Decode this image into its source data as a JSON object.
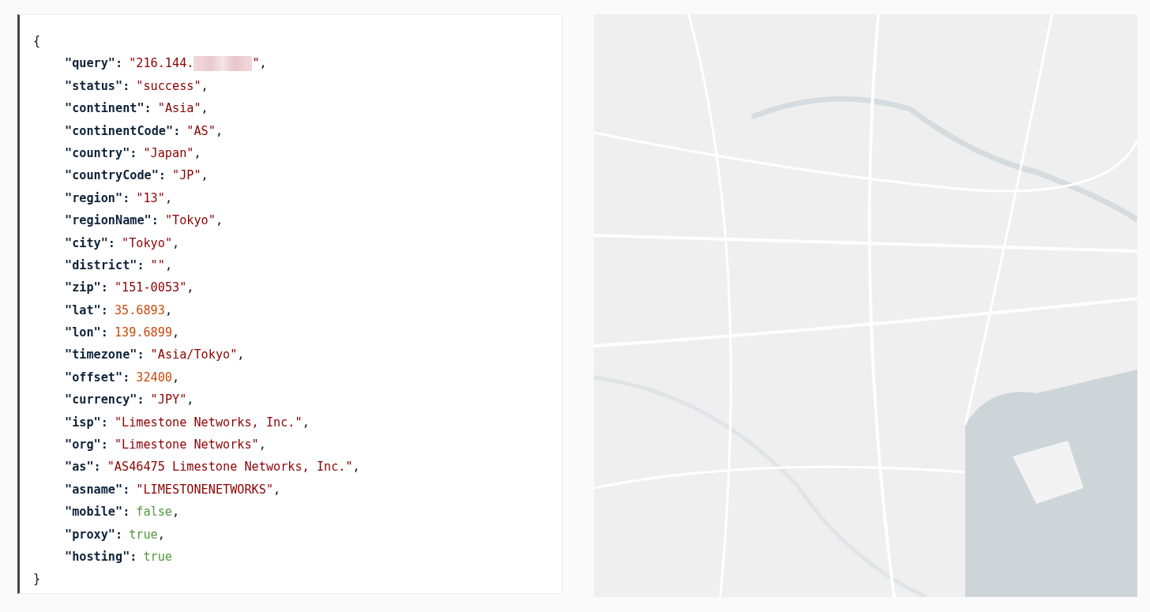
{
  "code_block": {
    "open": "{",
    "close": "}",
    "lines": [
      {
        "key": "\"query\":",
        "kind": "string",
        "value": "\"216.144.",
        "redacted": true,
        "value_end": "\"",
        "punct": ","
      },
      {
        "key": "\"status\":",
        "kind": "string",
        "value": "\"success\"",
        "punct": ","
      },
      {
        "key": "\"continent\":",
        "kind": "string",
        "value": "\"Asia\"",
        "punct": ","
      },
      {
        "key": "\"continentCode\":",
        "kind": "string",
        "value": "\"AS\"",
        "punct": ","
      },
      {
        "key": "\"country\":",
        "kind": "string",
        "value": "\"Japan\"",
        "punct": ","
      },
      {
        "key": "\"countryCode\":",
        "kind": "string",
        "value": "\"JP\"",
        "punct": ","
      },
      {
        "key": "\"region\":",
        "kind": "string",
        "value": "\"13\"",
        "punct": ","
      },
      {
        "key": "\"regionName\":",
        "kind": "string",
        "value": "\"Tokyo\"",
        "punct": ","
      },
      {
        "key": "\"city\":",
        "kind": "string",
        "value": "\"Tokyo\"",
        "punct": ","
      },
      {
        "key": "\"district\":",
        "kind": "string",
        "value": "\"\"",
        "punct": ","
      },
      {
        "key": "\"zip\":",
        "kind": "string",
        "value": "\"151-0053\"",
        "punct": ","
      },
      {
        "key": "\"lat\":",
        "kind": "number",
        "value": "35.6893",
        "punct": ","
      },
      {
        "key": "\"lon\":",
        "kind": "number",
        "value": "139.6899",
        "punct": ","
      },
      {
        "key": "\"timezone\":",
        "kind": "string",
        "value": "\"Asia/Tokyo\"",
        "punct": ","
      },
      {
        "key": "\"offset\":",
        "kind": "number",
        "value": "32400",
        "punct": ","
      },
      {
        "key": "\"currency\":",
        "kind": "string",
        "value": "\"JPY\"",
        "punct": ","
      },
      {
        "key": "\"isp\":",
        "kind": "string",
        "value": "\"Limestone Networks, Inc.\"",
        "punct": ","
      },
      {
        "key": "\"org\":",
        "kind": "string",
        "value": "\"Limestone Networks\"",
        "punct": ","
      },
      {
        "key": "\"as\":",
        "kind": "string",
        "value": "\"AS46475 Limestone Networks, Inc.\"",
        "punct": ","
      },
      {
        "key": "\"asname\":",
        "kind": "string",
        "value": "\"LIMESTONENETWORKS\"",
        "punct": ","
      },
      {
        "key": "\"mobile\":",
        "kind": "boolean",
        "value": "false",
        "punct": ","
      },
      {
        "key": "\"proxy\":",
        "kind": "boolean",
        "value": "true",
        "punct": ","
      },
      {
        "key": "\"hosting\":",
        "kind": "boolean",
        "value": "true"
      }
    ]
  }
}
